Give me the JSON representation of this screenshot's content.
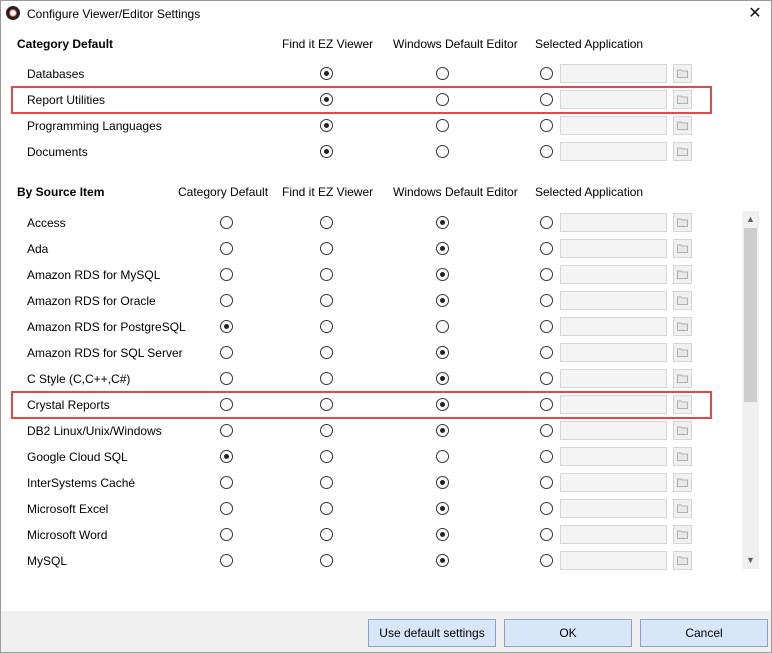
{
  "window": {
    "title": "Configure Viewer/Editor Settings",
    "close_glyph": "✕"
  },
  "category_default_section": {
    "heading": "Category Default",
    "columns": [
      "Find it EZ Viewer",
      "Windows Default Editor",
      "Selected Application"
    ],
    "rows": [
      {
        "label": "Databases",
        "selected": "Find it EZ Viewer",
        "highlighted": false
      },
      {
        "label": "Report Utilities",
        "selected": "Find it EZ Viewer",
        "highlighted": true
      },
      {
        "label": "Programming Languages",
        "selected": "Find it EZ Viewer",
        "highlighted": false
      },
      {
        "label": "Documents",
        "selected": "Find it EZ Viewer",
        "highlighted": false
      }
    ]
  },
  "source_item_section": {
    "heading": "By Source Item",
    "columns": [
      "Category Default",
      "Find it EZ Viewer",
      "Windows Default Editor",
      "Selected Application"
    ],
    "rows": [
      {
        "label": "Access",
        "selected": "Windows Default Editor",
        "highlighted": false
      },
      {
        "label": "Ada",
        "selected": "Windows Default Editor",
        "highlighted": false
      },
      {
        "label": "Amazon RDS for MySQL",
        "selected": "Windows Default Editor",
        "highlighted": false
      },
      {
        "label": "Amazon RDS for Oracle",
        "selected": "Windows Default Editor",
        "highlighted": false
      },
      {
        "label": "Amazon RDS for PostgreSQL",
        "selected": "Category Default",
        "highlighted": false
      },
      {
        "label": "Amazon RDS for SQL Server",
        "selected": "Windows Default Editor",
        "highlighted": false
      },
      {
        "label": "C Style (C,C++,C#)",
        "selected": "Windows Default Editor",
        "highlighted": false
      },
      {
        "label": "Crystal Reports",
        "selected": "Windows Default Editor",
        "highlighted": true
      },
      {
        "label": "DB2 Linux/Unix/Windows",
        "selected": "Windows Default Editor",
        "highlighted": false
      },
      {
        "label": "Google Cloud SQL",
        "selected": "Category Default",
        "highlighted": false
      },
      {
        "label": "InterSystems Caché",
        "selected": "Windows Default Editor",
        "highlighted": false
      },
      {
        "label": "Microsoft Excel",
        "selected": "Windows Default Editor",
        "highlighted": false
      },
      {
        "label": "Microsoft Word",
        "selected": "Windows Default Editor",
        "highlighted": false
      },
      {
        "label": "MySQL",
        "selected": "Windows Default Editor",
        "highlighted": false
      }
    ]
  },
  "scrollbar": {
    "up_glyph": "▲",
    "down_glyph": "▼"
  },
  "buttons": {
    "defaults": "Use default settings",
    "ok": "OK",
    "cancel": "Cancel"
  },
  "colors": {
    "highlight": "#e04a4a",
    "button_fill": "#d7e6f9",
    "button_border": "#8aa3c7"
  },
  "icons": {
    "app": "app-logo-icon",
    "close": "close-icon",
    "browse": "folder-icon"
  }
}
